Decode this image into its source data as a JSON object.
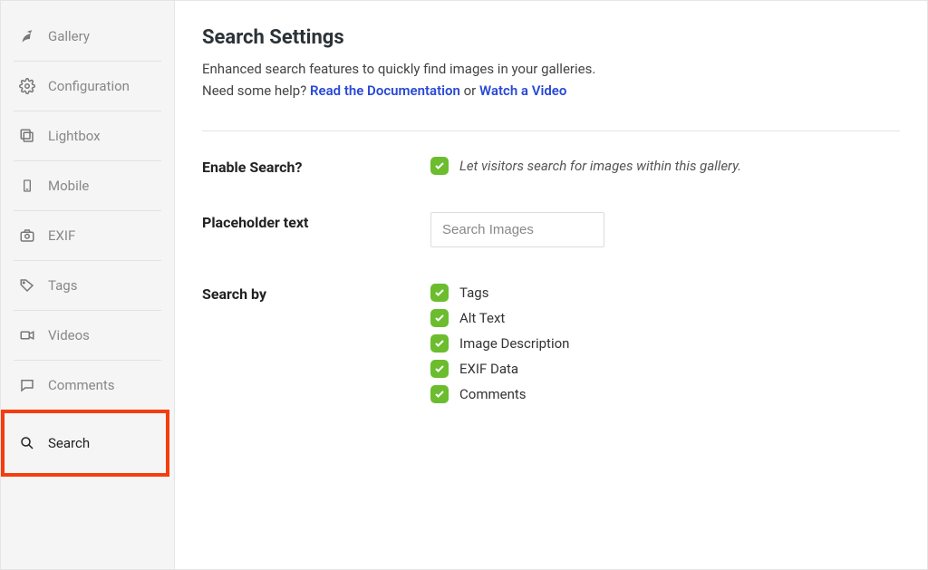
{
  "sidebar": {
    "items": [
      {
        "label": "Gallery"
      },
      {
        "label": "Configuration"
      },
      {
        "label": "Lightbox"
      },
      {
        "label": "Mobile"
      },
      {
        "label": "EXIF"
      },
      {
        "label": "Tags"
      },
      {
        "label": "Videos"
      },
      {
        "label": "Comments"
      },
      {
        "label": "Search"
      }
    ]
  },
  "main": {
    "title": "Search Settings",
    "subtitle_line1": "Enhanced search features to quickly find images in your galleries.",
    "help_prefix": "Need some help? ",
    "doc_link": "Read the Documentation",
    "or_text": " or ",
    "video_link": "Watch a Video",
    "enable_label": "Enable Search?",
    "enable_hint": "Let visitors search for images within this gallery.",
    "placeholder_label": "Placeholder text",
    "placeholder_value": "Search Images",
    "searchby_label": "Search by",
    "searchby_options": [
      "Tags",
      "Alt Text",
      "Image Description",
      "EXIF Data",
      "Comments"
    ]
  }
}
